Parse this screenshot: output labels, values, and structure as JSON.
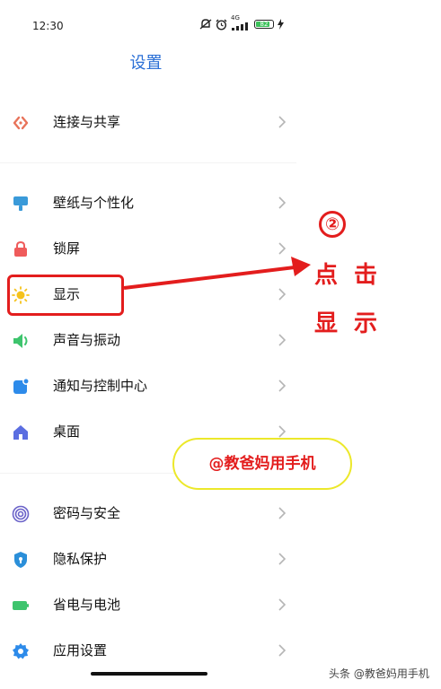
{
  "status_bar": {
    "time": "12:30",
    "network": "4G",
    "battery_level": "82",
    "battery_percent": 82,
    "icons": [
      "muted-bell-icon",
      "alarm-icon",
      "signal-icon",
      "battery-icon",
      "charging-icon"
    ]
  },
  "header": {
    "title": "设置"
  },
  "settings": {
    "items": [
      {
        "label": "连接与共享",
        "icon": "share-icon",
        "color": "#e8735a"
      },
      {
        "label": "壁纸与个性化",
        "icon": "wallpaper-icon",
        "color": "#3a9ad9"
      },
      {
        "label": "锁屏",
        "icon": "lock-icon",
        "color": "#ef5b5b"
      },
      {
        "label": "显示",
        "icon": "sun-icon",
        "color": "#f5c21b"
      },
      {
        "label": "声音与振动",
        "icon": "speaker-icon",
        "color": "#3ec46d"
      },
      {
        "label": "通知与控制中心",
        "icon": "notification-icon",
        "color": "#2d8bea"
      },
      {
        "label": "桌面",
        "icon": "home-icon",
        "color": "#5b6ee1"
      },
      {
        "label": "密码与安全",
        "icon": "fingerprint-icon",
        "color": "#6b63c9"
      },
      {
        "label": "隐私保护",
        "icon": "privacy-shield-icon",
        "color": "#2b8fd9"
      },
      {
        "label": "省电与电池",
        "icon": "battery-saver-icon",
        "color": "#3ec46d"
      },
      {
        "label": "应用设置",
        "icon": "gear-icon",
        "color": "#2d8bea"
      }
    ]
  },
  "annotation": {
    "step_number": "②",
    "instruction": "点击显示",
    "color": "#e31d1d"
  },
  "watermark": {
    "text": "@教爸妈用手机"
  },
  "footer": {
    "credit": "头条 @教爸妈用手机"
  }
}
